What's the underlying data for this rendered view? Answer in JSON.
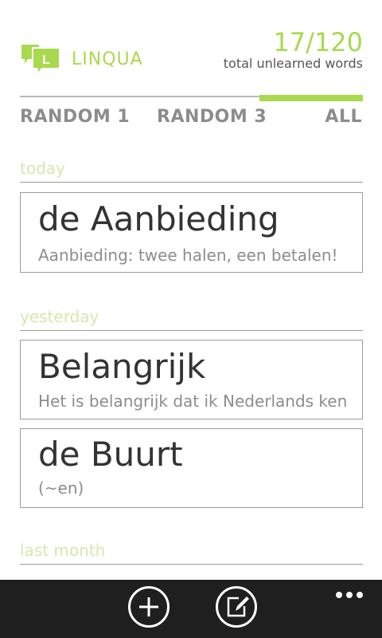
{
  "header": {
    "app_name": "LINQUA",
    "logo_letter": "L",
    "count": "17/120",
    "count_label": "total unlearned words"
  },
  "tabs": [
    {
      "label": "RANDOM 1"
    },
    {
      "label": "RANDOM 3"
    },
    {
      "label": "ALL",
      "active": true
    }
  ],
  "sections": [
    {
      "title": "today",
      "cards": [
        {
          "word": "de Aanbieding",
          "example": "Aanbieding: twee halen, een betalen!"
        }
      ]
    },
    {
      "title": "yesterday",
      "cards": [
        {
          "word": "Belangrijk",
          "example": "Het is belangrijk dat ik Nederlands ken"
        },
        {
          "word": "de Buurt",
          "example": "(~en)"
        }
      ]
    },
    {
      "title": "last month",
      "cards": []
    }
  ],
  "appbar": {
    "buttons": [
      {
        "icon": "add-icon"
      },
      {
        "icon": "edit-icon"
      }
    ],
    "more_icon": "more-icon"
  },
  "colors": {
    "accent": "#a9d94f",
    "appbar": "#1f1f1f"
  }
}
